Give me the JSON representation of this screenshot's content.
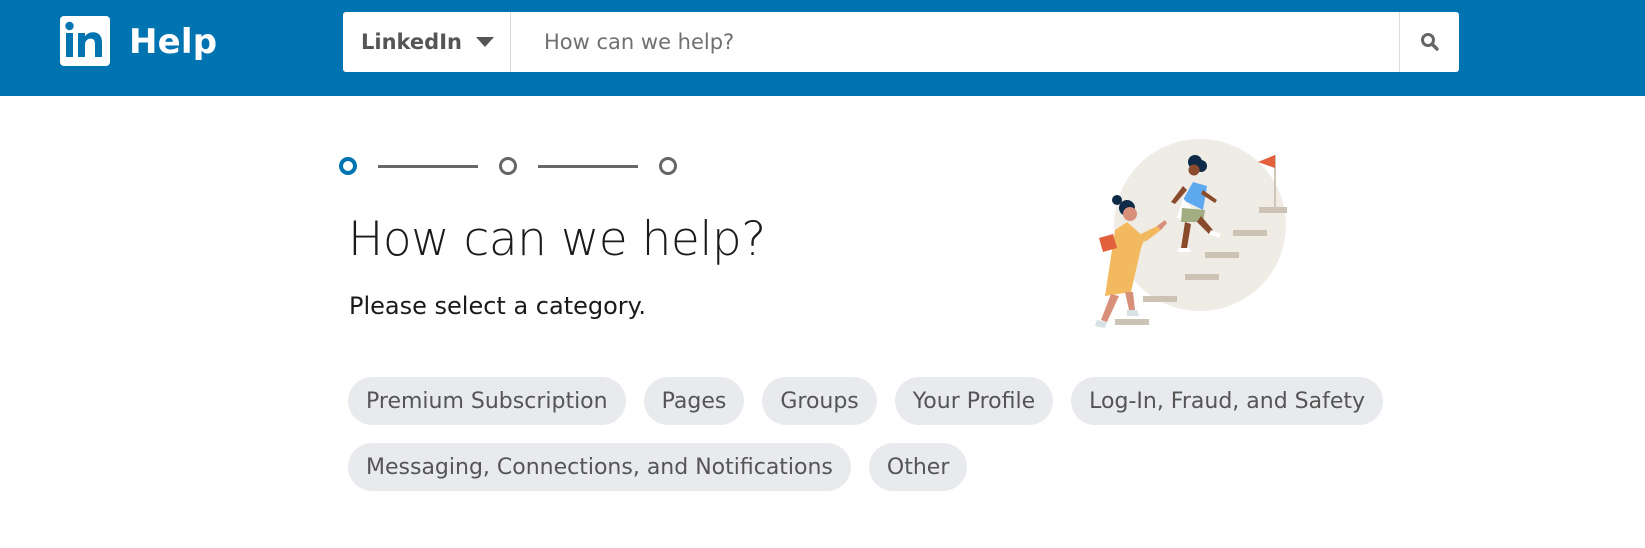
{
  "header": {
    "brand_logo": "linkedin-in-logo",
    "title": "Help",
    "search": {
      "scope_label": "LinkedIn",
      "scope_icon": "caret-down-icon",
      "placeholder": "How can we help?",
      "value": "",
      "button_icon": "search-icon"
    }
  },
  "stepper": {
    "total_steps": 3,
    "current_step": 1
  },
  "main": {
    "heading": "How can we help?",
    "subheading": "Please select a category.",
    "illustration": "people-climbing-stairs-illustration",
    "categories_row1": [
      "Premium Subscription",
      "Pages",
      "Groups",
      "Your Profile",
      "Log-In, Fraud, and Safety"
    ],
    "categories_row2": [
      "Messaging, Connections, and Notifications",
      "Other"
    ]
  },
  "colors": {
    "brand_blue": "#0073b1",
    "chip_bg": "#e8eaed",
    "chip_text": "#555555"
  }
}
